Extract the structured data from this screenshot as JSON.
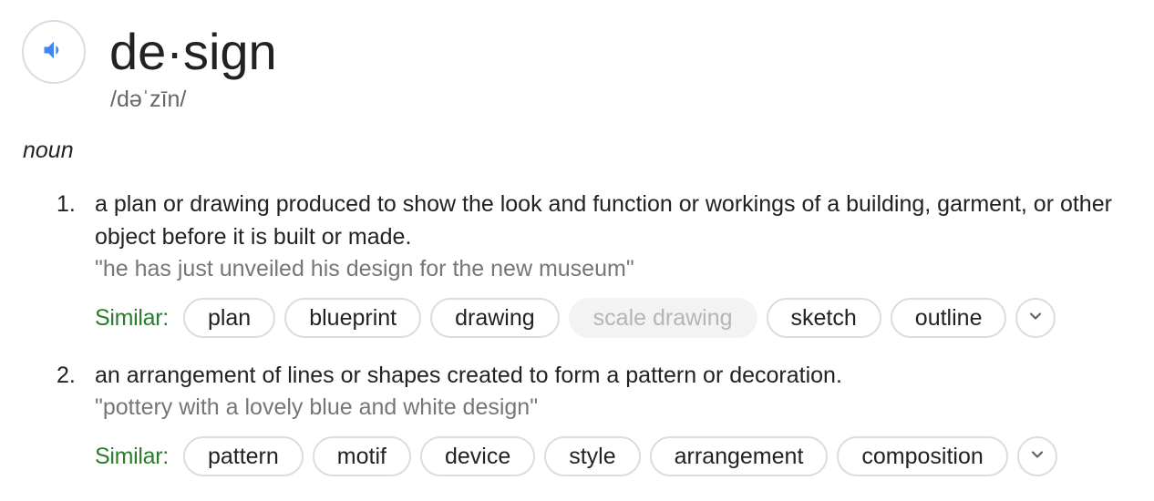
{
  "entry": {
    "word": "de·sign",
    "phonetic": "/dəˈzīn/",
    "part_of_speech": "noun"
  },
  "colors": {
    "similar_label": "#2a7d2e",
    "speaker_icon": "#4285f4",
    "chip_border": "#dadce0",
    "chip_disabled_bg": "#f3f3f3",
    "example_text": "#767676"
  },
  "icons": {
    "audio": "speaker-icon",
    "expand": "chevron-down-icon"
  },
  "senses": [
    {
      "number": "1.",
      "definition": "a plan or drawing produced to show the look and function or workings of a building, garment, or other object before it is built or made.",
      "example": "\"he has just unveiled his design for the new museum\"",
      "similar_label": "Similar:",
      "similar": [
        {
          "label": "plan",
          "disabled": false
        },
        {
          "label": "blueprint",
          "disabled": false
        },
        {
          "label": "drawing",
          "disabled": false
        },
        {
          "label": "scale drawing",
          "disabled": true
        },
        {
          "label": "sketch",
          "disabled": false
        },
        {
          "label": "outline",
          "disabled": false
        }
      ]
    },
    {
      "number": "2.",
      "definition": "an arrangement of lines or shapes created to form a pattern or decoration.",
      "example": "\"pottery with a lovely blue and white design\"",
      "similar_label": "Similar:",
      "similar": [
        {
          "label": "pattern",
          "disabled": false
        },
        {
          "label": "motif",
          "disabled": false
        },
        {
          "label": "device",
          "disabled": false
        },
        {
          "label": "style",
          "disabled": false
        },
        {
          "label": "arrangement",
          "disabled": false
        },
        {
          "label": "composition",
          "disabled": false
        }
      ]
    }
  ]
}
